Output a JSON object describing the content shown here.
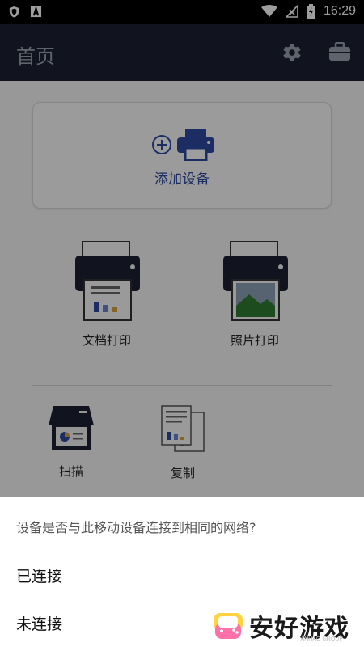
{
  "status_bar": {
    "time": "16:29",
    "left_icons": [
      "shield-notification-icon",
      "a-notification-icon"
    ],
    "right_icons": [
      "wifi-icon",
      "no-signal-icon",
      "battery-charging-icon"
    ]
  },
  "app_bar": {
    "title": "首页",
    "actions": [
      "settings-gear-icon",
      "toolbox-icon"
    ],
    "background": "#1c2133"
  },
  "add_device": {
    "label": "添加设备",
    "accent": "#2e4aa1"
  },
  "functions": {
    "document_print": "文档打印",
    "photo_print": "照片打印",
    "scan": "扫描",
    "copy": "复制"
  },
  "sheet": {
    "question": "设备是否与此移动设备连接到相同的网络?",
    "options": [
      "已连接",
      "未连接"
    ]
  },
  "watermark": {
    "text": "安好游戏",
    "sub": "ANHAO GROUP"
  }
}
